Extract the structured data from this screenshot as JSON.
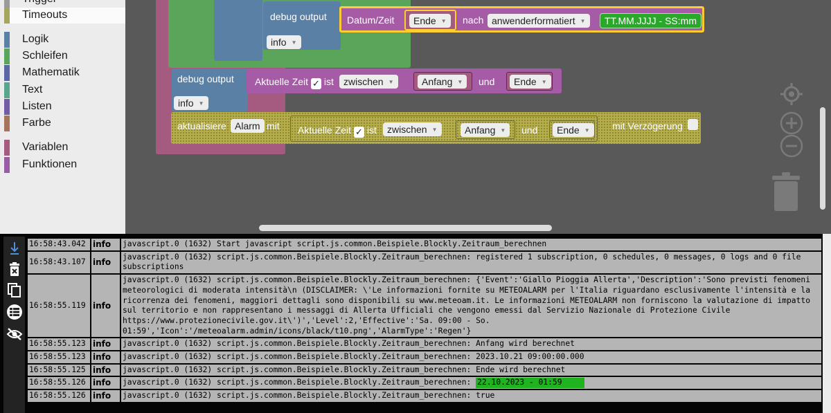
{
  "toolbox": {
    "categories": [
      {
        "label": "Trigger",
        "color": "#9a9a9a"
      },
      {
        "label": "Timeouts",
        "color": "#a5a55b"
      },
      {
        "label": "Logik",
        "color": "#5b80a5"
      },
      {
        "label": "Schleifen",
        "color": "#5ba55b"
      },
      {
        "label": "Mathematik",
        "color": "#5b67a5"
      },
      {
        "label": "Text",
        "color": "#5ba58c"
      },
      {
        "label": "Listen",
        "color": "#745ba5"
      },
      {
        "label": "Farbe",
        "color": "#a5745b"
      },
      {
        "label": "Variablen",
        "color": "#a55b80"
      },
      {
        "label": "Funktionen",
        "color": "#995ba5"
      }
    ]
  },
  "workspace": {
    "block1": {
      "label": "debug output",
      "level": "info",
      "datetime_label": "Datum/Zeit",
      "var": "Ende",
      "nach_label": "nach",
      "format_mode": "anwenderformatiert",
      "format_text": "TT.MM.JJJJ - SS:mm"
    },
    "block2": {
      "label": "debug output",
      "level": "info",
      "time_label": "Aktuelle Zeit",
      "check": "✓",
      "ist_label": "ist",
      "compare": "zwischen",
      "var_a": "Anfang",
      "und_label": "und",
      "var_b": "Ende"
    },
    "block3": {
      "label": "aktualisiere",
      "state": "Alarm",
      "mit_label": "mit",
      "time_label": "Aktuelle Zeit",
      "check": "✓",
      "ist_label": "ist",
      "compare": "zwischen",
      "var_a": "Anfang",
      "und_label": "und",
      "var_b": "Ende",
      "delay_label": "mit Verzögerung"
    },
    "colors": {
      "purple": "#a55ba5",
      "blue": "#5b80a5",
      "green": "#5ba55b",
      "pink": "#a55b80",
      "highlight": "#fc3"
    }
  },
  "log": {
    "rows": [
      {
        "time": "16:58:43.042",
        "level": "info",
        "msg": "javascript.0 (1632) Start javascript script.js.common.Beispiele.Blockly.Zeitraum_berechnen"
      },
      {
        "time": "16:58:43.107",
        "level": "info",
        "msg": "javascript.0 (1632) script.js.common.Beispiele.Blockly.Zeitraum_berechnen: registered 1 subscription, 0 schedules, 0 messages, 0 logs and 0 file subscriptions"
      },
      {
        "time": "16:58:55.119",
        "level": "info",
        "msg": "javascript.0 (1632) script.js.common.Beispiele.Blockly.Zeitraum_berechnen: {'Event':'Giallo Pioggia Allerta','Description':'Sono previsti fenomeni meteorologici di moderata intensità\\n (DISCLAIMER: \\'Le informazioni fornite su METEOALARM per l'Italia riguardano esclusivamente l'intensità e la ricorrenza dei fenomeni, maggiori dettagli sono disponibili su www.meteoam.it. Le informazioni METEOALARM non forniscono la valutazione di impatto sul territorio e non rappresentano i messaggi di Allerta Ufficiali che vengono emessi dal Servizio Nazionale di Protezione Civile https://www.protezionecivile.gov.it\\')','Level':2,'Effective':'Sa. 09:00 - So. 01:59','Icon':'/meteoalarm.admin/icons/black/t10.png','AlarmType':'Regen'}"
      },
      {
        "time": "16:58:55.123",
        "level": "info",
        "msg": "javascript.0 (1632) script.js.common.Beispiele.Blockly.Zeitraum_berechnen: Anfang wird berechnet"
      },
      {
        "time": "16:58:55.123",
        "level": "info",
        "msg": "javascript.0 (1632) script.js.common.Beispiele.Blockly.Zeitraum_berechnen: 2023.10.21 09:00:00.000"
      },
      {
        "time": "16:58:55.125",
        "level": "info",
        "msg": "javascript.0 (1632) script.js.common.Beispiele.Blockly.Zeitraum_berechnen: Ende wird berechnet"
      },
      {
        "time": "16:58:55.126",
        "level": "info",
        "msg": "javascript.0 (1632) script.js.common.Beispiele.Blockly.Zeitraum_berechnen: ",
        "highlight": "22.10.2023 - 01:59"
      },
      {
        "time": "16:58:55.126",
        "level": "info",
        "msg": "javascript.0 (1632) script.js.common.Beispiele.Blockly.Zeitraum_berechnen: true"
      }
    ],
    "highlight_color": "#1fb31f"
  }
}
